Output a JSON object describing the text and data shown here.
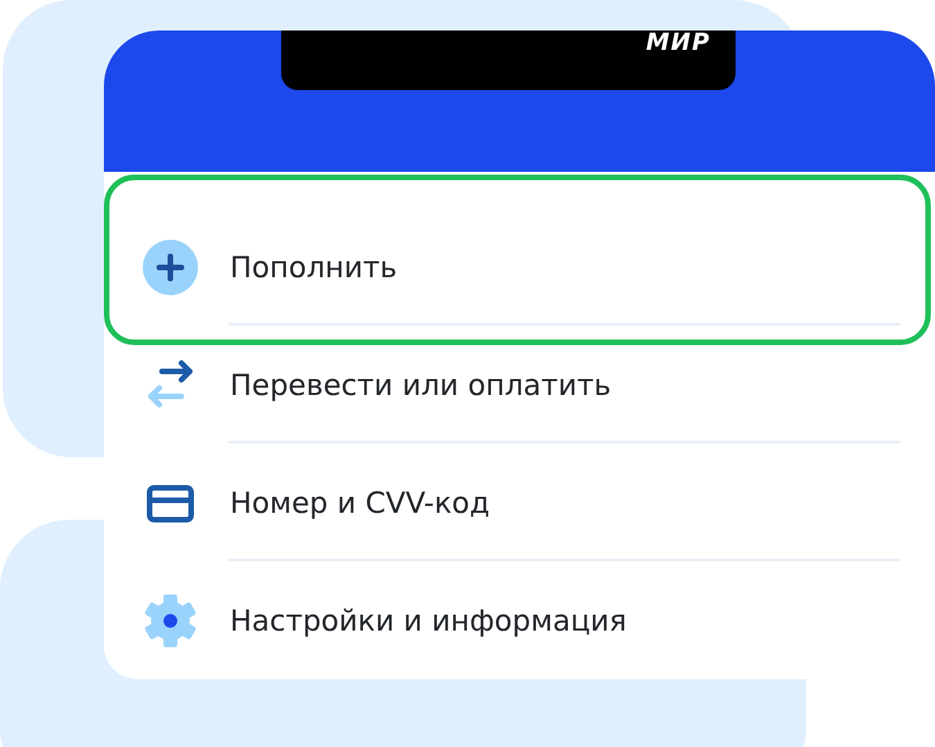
{
  "card": {
    "brand": "МИР"
  },
  "menu": [
    {
      "kind": "top-up",
      "label": "Пополнить",
      "selected": true
    },
    {
      "kind": "transfer",
      "label": "Перевести или оплатить",
      "selected": false
    },
    {
      "kind": "card-number",
      "label": "Номер и CVV-код",
      "selected": false
    },
    {
      "kind": "settings",
      "label": "Настройки и информация",
      "selected": false
    }
  ]
}
